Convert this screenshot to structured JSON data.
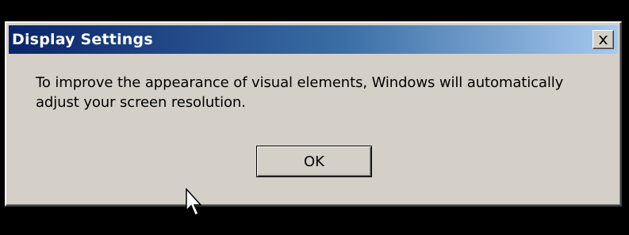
{
  "dialog": {
    "title": "Display Settings",
    "message_line1": "To improve the appearance of visual elements, Windows will automatically",
    "message_line2": "adjust your screen resolution.",
    "ok_label": "OK",
    "close_icon": "close-icon"
  },
  "pointer": {
    "icon": "mouse-pointer-icon"
  },
  "colors": {
    "title_gradient_start": "#0a246a",
    "title_gradient_end": "#a6caf0",
    "dialog_face": "#d4d0c8",
    "background": "#000000"
  }
}
